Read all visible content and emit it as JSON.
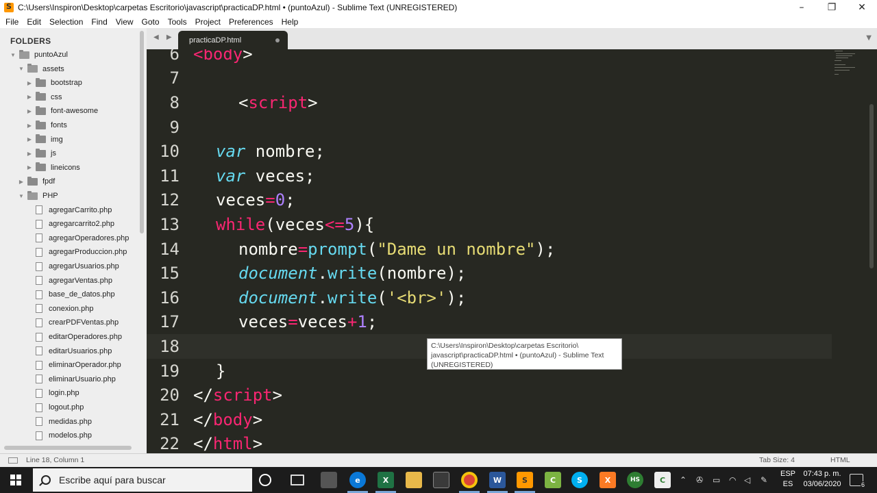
{
  "window": {
    "title": "C:\\Users\\Inspiron\\Desktop\\carpetas Escritorio\\javascript\\practicaDP.html • (puntoAzul) - Sublime Text (UNREGISTERED)",
    "minimize": "–",
    "maximize": "❐",
    "close": "✕"
  },
  "menu": [
    "File",
    "Edit",
    "Selection",
    "Find",
    "View",
    "Goto",
    "Tools",
    "Project",
    "Preferences",
    "Help"
  ],
  "sidebar": {
    "header": "FOLDERS",
    "tree": [
      {
        "label": "puntoAzul",
        "type": "folder",
        "open": true,
        "depth": 0
      },
      {
        "label": "assets",
        "type": "folder",
        "open": true,
        "depth": 1
      },
      {
        "label": "bootstrap",
        "type": "folder",
        "open": false,
        "depth": 2
      },
      {
        "label": "css",
        "type": "folder",
        "open": false,
        "depth": 2
      },
      {
        "label": "font-awesome",
        "type": "folder",
        "open": false,
        "depth": 2
      },
      {
        "label": "fonts",
        "type": "folder",
        "open": false,
        "depth": 2
      },
      {
        "label": "img",
        "type": "folder",
        "open": false,
        "depth": 2
      },
      {
        "label": "js",
        "type": "folder",
        "open": false,
        "depth": 2
      },
      {
        "label": "lineicons",
        "type": "folder",
        "open": false,
        "depth": 2
      },
      {
        "label": "fpdf",
        "type": "folder",
        "open": false,
        "depth": 1
      },
      {
        "label": "PHP",
        "type": "folder",
        "open": true,
        "depth": 1
      },
      {
        "label": "agregarCarrito.php",
        "type": "file",
        "depth": 2
      },
      {
        "label": "agregarcarrito2.php",
        "type": "file",
        "depth": 2
      },
      {
        "label": "agregarOperadores.php",
        "type": "file",
        "depth": 2
      },
      {
        "label": "agregarProduccion.php",
        "type": "file",
        "depth": 2
      },
      {
        "label": "agregarUsuarios.php",
        "type": "file",
        "depth": 2
      },
      {
        "label": "agregarVentas.php",
        "type": "file",
        "depth": 2
      },
      {
        "label": "base_de_datos.php",
        "type": "file",
        "depth": 2
      },
      {
        "label": "conexion.php",
        "type": "file",
        "depth": 2
      },
      {
        "label": "crearPDFVentas.php",
        "type": "file",
        "depth": 2
      },
      {
        "label": "editarOperadores.php",
        "type": "file",
        "depth": 2
      },
      {
        "label": "editarUsuarios.php",
        "type": "file",
        "depth": 2
      },
      {
        "label": "eliminarOperador.php",
        "type": "file",
        "depth": 2
      },
      {
        "label": "eliminarUsuario.php",
        "type": "file",
        "depth": 2
      },
      {
        "label": "login.php",
        "type": "file",
        "depth": 2
      },
      {
        "label": "logout.php",
        "type": "file",
        "depth": 2
      },
      {
        "label": "medidas.php",
        "type": "file",
        "depth": 2
      },
      {
        "label": "modelos.php",
        "type": "file",
        "depth": 2
      }
    ]
  },
  "tabs": {
    "nav": "◀ ▶",
    "active": "practicaDP.html",
    "overflow": "▼"
  },
  "editor": {
    "active_line": 18,
    "lines": [
      {
        "n": "6",
        "tokens": [
          [
            "tag",
            "<"
          ],
          [
            "tag",
            "body"
          ],
          [
            "pl",
            ">"
          ]
        ],
        "indent": 0
      },
      {
        "n": "7",
        "tokens": [],
        "indent": 0
      },
      {
        "n": "8",
        "tokens": [
          [
            "pl",
            "<"
          ],
          [
            "tag",
            "script"
          ],
          [
            "pl",
            ">"
          ]
        ],
        "indent": 2
      },
      {
        "n": "9",
        "tokens": [],
        "indent": 0
      },
      {
        "n": "10",
        "tokens": [
          [
            "kw",
            "var"
          ],
          [
            "pl",
            " nombre;"
          ]
        ],
        "indent": 1
      },
      {
        "n": "11",
        "tokens": [
          [
            "kw",
            "var"
          ],
          [
            "pl",
            " veces;"
          ]
        ],
        "indent": 1
      },
      {
        "n": "12",
        "tokens": [
          [
            "pl",
            "veces"
          ],
          [
            "op",
            "="
          ],
          [
            "num",
            "0"
          ],
          [
            "pl",
            ";"
          ]
        ],
        "indent": 1
      },
      {
        "n": "13",
        "tokens": [
          [
            "ctl",
            "while"
          ],
          [
            "pl",
            "(veces"
          ],
          [
            "op",
            "<="
          ],
          [
            "num",
            "5"
          ],
          [
            "pl",
            "){"
          ]
        ],
        "indent": 1
      },
      {
        "n": "14",
        "tokens": [
          [
            "pl",
            "nombre"
          ],
          [
            "op",
            "="
          ],
          [
            "fn",
            "prompt"
          ],
          [
            "pl",
            "("
          ],
          [
            "str",
            "\"Dame un nombre\""
          ],
          [
            "pl",
            ");"
          ]
        ],
        "indent": 2
      },
      {
        "n": "15",
        "tokens": [
          [
            "kw",
            "document"
          ],
          [
            "pl",
            "."
          ],
          [
            "fn",
            "write"
          ],
          [
            "pl",
            "(nombre);"
          ]
        ],
        "indent": 2
      },
      {
        "n": "16",
        "tokens": [
          [
            "kw",
            "document"
          ],
          [
            "pl",
            "."
          ],
          [
            "fn",
            "write"
          ],
          [
            "pl",
            "("
          ],
          [
            "str",
            "'<br>'"
          ],
          [
            "pl",
            ");"
          ]
        ],
        "indent": 2
      },
      {
        "n": "17",
        "tokens": [
          [
            "pl",
            "veces"
          ],
          [
            "op",
            "="
          ],
          [
            "pl",
            "veces"
          ],
          [
            "op",
            "+"
          ],
          [
            "num",
            "1"
          ],
          [
            "pl",
            ";"
          ]
        ],
        "indent": 2
      },
      {
        "n": "18",
        "tokens": [],
        "indent": 0
      },
      {
        "n": "19",
        "tokens": [
          [
            "pl",
            "}"
          ]
        ],
        "indent": 1
      },
      {
        "n": "20",
        "tokens": [
          [
            "pl",
            "</"
          ],
          [
            "tag",
            "script"
          ],
          [
            "pl",
            ">"
          ]
        ],
        "indent": 0
      },
      {
        "n": "21",
        "tokens": [
          [
            "pl",
            "</"
          ],
          [
            "tag",
            "body"
          ],
          [
            "pl",
            ">"
          ]
        ],
        "indent": 0
      },
      {
        "n": "22",
        "tokens": [
          [
            "pl",
            "</"
          ],
          [
            "tag",
            "html"
          ],
          [
            "pl",
            ">"
          ]
        ],
        "indent": 0
      }
    ]
  },
  "tooltip": {
    "text": "C:\\Users\\Inspiron\\Desktop\\carpetas Escritorio\\ javascript\\practicaDP.html • (puntoAzul) - Sublime Text (UNREGISTERED)"
  },
  "status": {
    "position": "Line 18, Column 1",
    "tab_size": "Tab Size: 4",
    "syntax": "HTML"
  },
  "taskbar": {
    "search_placeholder": "Escribe aquí para buscar",
    "lang_top": "ESP",
    "lang_bottom": "ES",
    "time": "07:43 p. m.",
    "date": "03/06/2020",
    "notifications": "6"
  },
  "colors": {
    "editor_bg": "#272822",
    "tag": "#f92672",
    "keyword": "#66d9ef",
    "string": "#e6db74",
    "number": "#ae81ff"
  }
}
